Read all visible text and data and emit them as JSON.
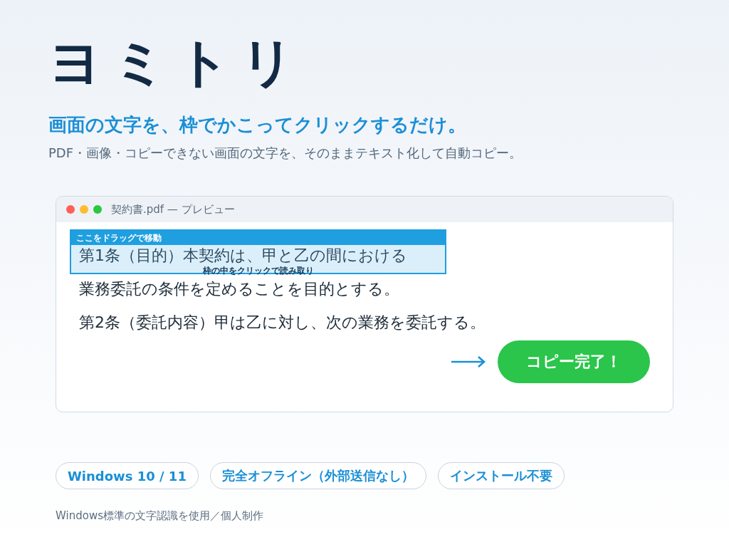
{
  "app_title": "ヨミトリ",
  "tagline": "画面の文字を、枠でかこってクリックするだけ。",
  "description": "PDF・画像・コピーできない画面の文字を、そのままテキスト化して自動コピー。",
  "preview": {
    "window_dots": [
      {
        "color": "#ff5f57"
      },
      {
        "color": "#febc2e"
      },
      {
        "color": "#28c840"
      }
    ],
    "window_title": "契約書.pdf — プレビュー",
    "document_lines": [
      "第1条（目的）本契約は、甲と乙の間における",
      "業務委託の条件を定めることを目的とする。",
      "第2条（委託内容）甲は乙に対し、次の業務を委託する。"
    ],
    "selection_frame": {
      "header": "ここをドラッグで移動",
      "hint": "枠の中をクリックで読み取り"
    },
    "copy_button": "コピー完了！"
  },
  "badges": [
    "Windows 10 / 11",
    "完全オフライン（外部送信なし）",
    "インストール不要"
  ],
  "footer": "Windows標準の文字認識を使用／個人制作"
}
